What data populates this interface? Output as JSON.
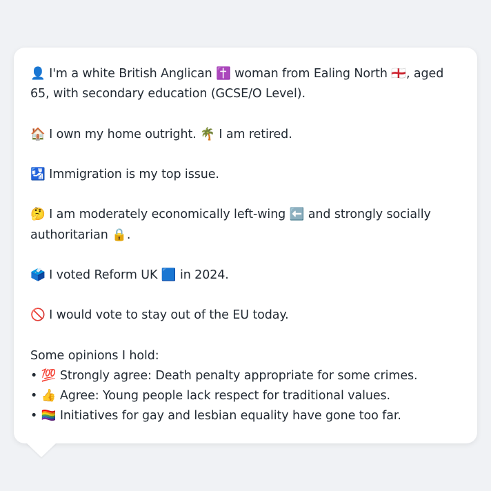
{
  "persona": {
    "line1": "👤 I'm a white British Anglican ✝️ woman from Ealing North 🏴󠁧󠁢󠁥󠁮󠁧󠁿, aged 65, with secondary education (GCSE/O Level).",
    "line2": "🏠 I own my home outright. 🌴 I am retired.",
    "line3": "🛂 Immigration is my top issue.",
    "line4": "🤔 I am moderately economically left-wing ⬅️ and strongly socially authoritarian 🔒.",
    "line5": "🗳️ I voted Reform UK 🟦 in 2024.",
    "line6": "🚫 I would vote to stay out of the EU today.",
    "opinions_heading": "Some opinions I hold:",
    "opinions": [
      "• 💯 Strongly agree: Death penalty appropriate for some crimes.",
      "• 👍 Agree: Young people lack respect for traditional values.",
      "• 🏳️‍🌈 Initiatives for gay and lesbian equality have gone too far."
    ]
  }
}
